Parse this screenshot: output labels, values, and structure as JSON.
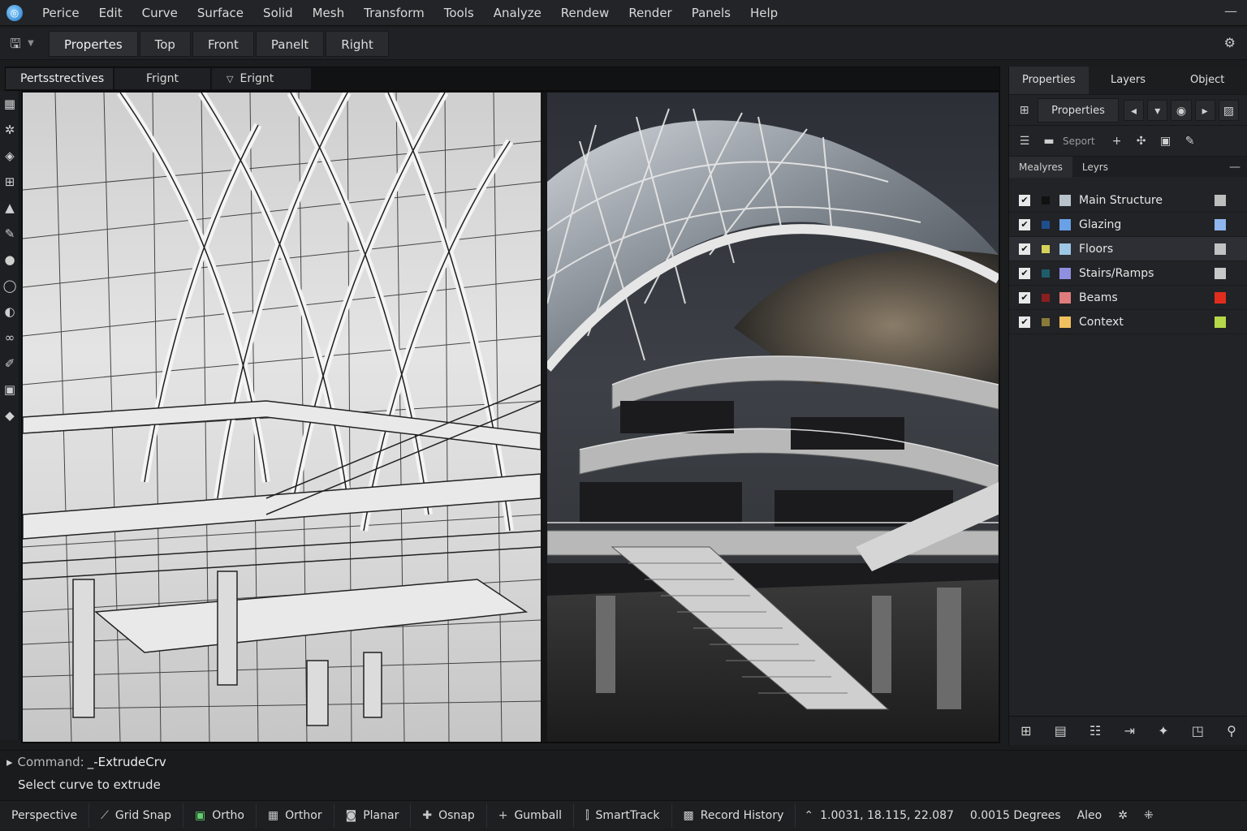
{
  "app": {
    "icon": "app-globe-icon"
  },
  "menu": [
    "Perice",
    "Edit",
    "Curve",
    "Surface",
    "Solid",
    "Mesh",
    "Transform",
    "Tools",
    "Analyze",
    "Rendew",
    "Render",
    "Panels",
    "Help"
  ],
  "toolbar": {
    "tabs": [
      "Propertes",
      "Top",
      "Front",
      "Panelt",
      "Right"
    ],
    "active": 0
  },
  "viewport_tabs": {
    "labels": [
      "Pertsstrectives",
      "Frignt",
      "Erignt"
    ],
    "active": 0
  },
  "right_panel": {
    "tabs": [
      "Properties",
      "Layers",
      "Object"
    ],
    "active": 0,
    "properties_button": "Properties",
    "export_label": "Seport",
    "subtabs": [
      "Mealyres",
      "Leyrs"
    ],
    "layers": [
      {
        "name": "Main Structure",
        "dot": "#111111",
        "swatch": "#b9c3cc",
        "color": "#bdbdbd",
        "checked": true
      },
      {
        "name": "Glazing",
        "dot": "#1f4e8c",
        "swatch": "#6aa0e6",
        "color": "#8fb6ee",
        "checked": true
      },
      {
        "name": "Floors",
        "dot": "#d7d25a",
        "swatch": "#9ec7e6",
        "color": "#c2c2c2",
        "checked": true,
        "selected": true
      },
      {
        "name": "Stairs/Ramps",
        "dot": "#1f5c6a",
        "swatch": "#8f8fe0",
        "color": "#c8c8c8",
        "checked": true
      },
      {
        "name": "Beams",
        "dot": "#8a1f1f",
        "swatch": "#e07c7c",
        "color": "#e02d1e",
        "checked": true
      },
      {
        "name": "Context",
        "dot": "#8a7a3a",
        "swatch": "#f0c060",
        "color": "#b4d84a",
        "checked": true
      }
    ]
  },
  "command": {
    "label": "Command:",
    "value": "_-ExtrudeCrv",
    "prompt": "Select curve to extrude"
  },
  "status": {
    "items": [
      "Perspective",
      "Grid Snap",
      "Ortho",
      "Orthor",
      "Planar",
      "Osnap",
      "Gumball",
      "SmartTrack",
      "Record History"
    ],
    "coords": "1.0031, 18.115, 22.087",
    "units": "0.0015 Degrees",
    "user": "Aleo"
  }
}
